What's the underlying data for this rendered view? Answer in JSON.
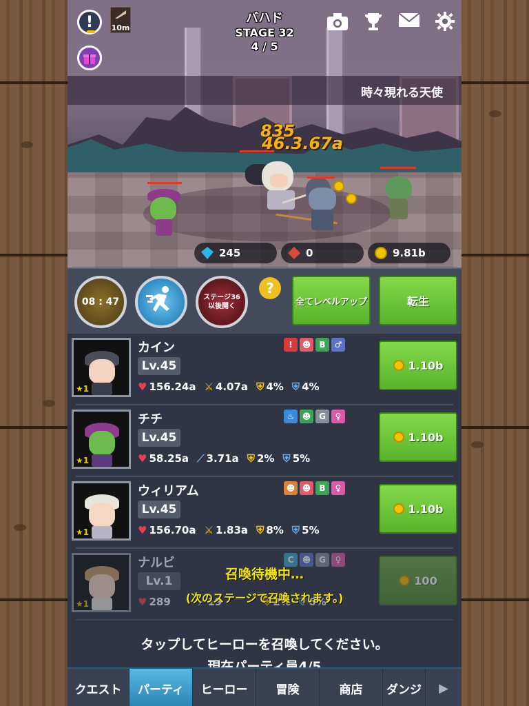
{
  "header": {
    "stage_name": "バハド",
    "stage": "STAGE 32",
    "wave": "4 / 5",
    "boost_time": "10m"
  },
  "ticker_text": "時々現れる天使",
  "damage": {
    "first": "835",
    "second": "46.3.67a"
  },
  "currency": {
    "gems": "245",
    "souls": "0",
    "gold": "9.81b"
  },
  "controls": {
    "timer": "08 : 47",
    "locked_label": "ステージ36以後開く",
    "help": "?",
    "level_all": "全てレベルアップ",
    "rebirth": "転生"
  },
  "heroes": [
    {
      "name": "カイン",
      "level": "Lv.45",
      "hp": "156.24a",
      "atk": "4.07a",
      "def1": "4%",
      "def2": "4%",
      "star": "1",
      "price": "1.10b",
      "badges": [
        {
          "label": "!",
          "color": "#d83a3a"
        },
        {
          "label": "☻",
          "color": "#e05a6a"
        },
        {
          "label": "B",
          "color": "#3da356"
        },
        {
          "label": "♂",
          "color": "#5b74c8"
        }
      ]
    },
    {
      "name": "チチ",
      "level": "Lv.45",
      "hp": "58.25a",
      "atk": "3.71a",
      "def1": "2%",
      "def2": "5%",
      "star": "1",
      "price": "1.10b",
      "badges": [
        {
          "label": "♨",
          "color": "#3a8ad8"
        },
        {
          "label": "☻",
          "color": "#3da356"
        },
        {
          "label": "G",
          "color": "#8a8f99"
        },
        {
          "label": "♀",
          "color": "#d85aa8"
        }
      ]
    },
    {
      "name": "ウィリアム",
      "level": "Lv.45",
      "hp": "156.70a",
      "atk": "1.83a",
      "def1": "8%",
      "def2": "5%",
      "star": "1",
      "price": "1.10b",
      "badges": [
        {
          "label": "☻",
          "color": "#d8823a"
        },
        {
          "label": "☻",
          "color": "#e05a6a"
        },
        {
          "label": "B",
          "color": "#3da356"
        },
        {
          "label": "♀",
          "color": "#d85aa8"
        }
      ]
    },
    {
      "name": "ナルビ",
      "level": "Lv.1",
      "hp": "289",
      "atk": "19",
      "def1": "2%",
      "def2": "6%",
      "star": "1",
      "price": "100",
      "badges": [
        {
          "label": "C",
          "color": "#3aa8c8"
        },
        {
          "label": "☻",
          "color": "#5b74c8"
        },
        {
          "label": "G",
          "color": "#8a8f99"
        },
        {
          "label": "♀",
          "color": "#d85aa8"
        }
      ]
    }
  ],
  "pending": {
    "line1": "召喚待機中…",
    "line2": "(次のステージで召喚されます。)"
  },
  "tap_message": "タップしてヒーローを召喚してください。",
  "party_count": "現在パーティ員4/5",
  "tabs": [
    "クエスト",
    "パーティ",
    "ヒーロー",
    "冒険",
    "商店",
    "ダンジ",
    "▶"
  ],
  "colors": {
    "accent_green": "#6cc63a",
    "tab_active": "#3a9ed0",
    "gold": "#f2c300"
  },
  "icons": {
    "top_right": [
      "camera-icon",
      "trophy-icon",
      "mail-icon",
      "gear-icon"
    ]
  }
}
